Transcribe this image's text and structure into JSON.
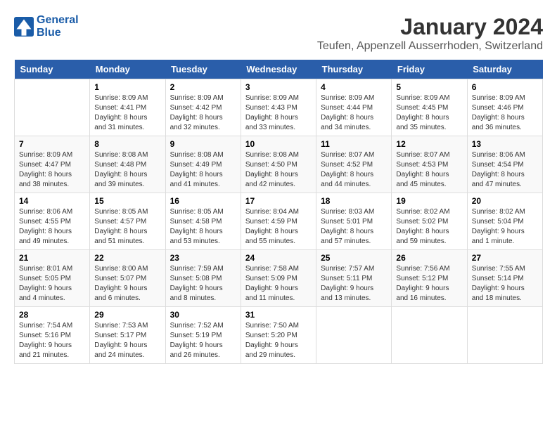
{
  "logo": {
    "line1": "General",
    "line2": "Blue"
  },
  "title": "January 2024",
  "subtitle": "Teufen, Appenzell Ausserrhoden, Switzerland",
  "days_header": [
    "Sunday",
    "Monday",
    "Tuesday",
    "Wednesday",
    "Thursday",
    "Friday",
    "Saturday"
  ],
  "weeks": [
    [
      {
        "day": "",
        "sunrise": "",
        "sunset": "",
        "daylight": ""
      },
      {
        "day": "1",
        "sunrise": "Sunrise: 8:09 AM",
        "sunset": "Sunset: 4:41 PM",
        "daylight": "Daylight: 8 hours and 31 minutes."
      },
      {
        "day": "2",
        "sunrise": "Sunrise: 8:09 AM",
        "sunset": "Sunset: 4:42 PM",
        "daylight": "Daylight: 8 hours and 32 minutes."
      },
      {
        "day": "3",
        "sunrise": "Sunrise: 8:09 AM",
        "sunset": "Sunset: 4:43 PM",
        "daylight": "Daylight: 8 hours and 33 minutes."
      },
      {
        "day": "4",
        "sunrise": "Sunrise: 8:09 AM",
        "sunset": "Sunset: 4:44 PM",
        "daylight": "Daylight: 8 hours and 34 minutes."
      },
      {
        "day": "5",
        "sunrise": "Sunrise: 8:09 AM",
        "sunset": "Sunset: 4:45 PM",
        "daylight": "Daylight: 8 hours and 35 minutes."
      },
      {
        "day": "6",
        "sunrise": "Sunrise: 8:09 AM",
        "sunset": "Sunset: 4:46 PM",
        "daylight": "Daylight: 8 hours and 36 minutes."
      }
    ],
    [
      {
        "day": "7",
        "sunrise": "Sunrise: 8:09 AM",
        "sunset": "Sunset: 4:47 PM",
        "daylight": "Daylight: 8 hours and 38 minutes."
      },
      {
        "day": "8",
        "sunrise": "Sunrise: 8:08 AM",
        "sunset": "Sunset: 4:48 PM",
        "daylight": "Daylight: 8 hours and 39 minutes."
      },
      {
        "day": "9",
        "sunrise": "Sunrise: 8:08 AM",
        "sunset": "Sunset: 4:49 PM",
        "daylight": "Daylight: 8 hours and 41 minutes."
      },
      {
        "day": "10",
        "sunrise": "Sunrise: 8:08 AM",
        "sunset": "Sunset: 4:50 PM",
        "daylight": "Daylight: 8 hours and 42 minutes."
      },
      {
        "day": "11",
        "sunrise": "Sunrise: 8:07 AM",
        "sunset": "Sunset: 4:52 PM",
        "daylight": "Daylight: 8 hours and 44 minutes."
      },
      {
        "day": "12",
        "sunrise": "Sunrise: 8:07 AM",
        "sunset": "Sunset: 4:53 PM",
        "daylight": "Daylight: 8 hours and 45 minutes."
      },
      {
        "day": "13",
        "sunrise": "Sunrise: 8:06 AM",
        "sunset": "Sunset: 4:54 PM",
        "daylight": "Daylight: 8 hours and 47 minutes."
      }
    ],
    [
      {
        "day": "14",
        "sunrise": "Sunrise: 8:06 AM",
        "sunset": "Sunset: 4:55 PM",
        "daylight": "Daylight: 8 hours and 49 minutes."
      },
      {
        "day": "15",
        "sunrise": "Sunrise: 8:05 AM",
        "sunset": "Sunset: 4:57 PM",
        "daylight": "Daylight: 8 hours and 51 minutes."
      },
      {
        "day": "16",
        "sunrise": "Sunrise: 8:05 AM",
        "sunset": "Sunset: 4:58 PM",
        "daylight": "Daylight: 8 hours and 53 minutes."
      },
      {
        "day": "17",
        "sunrise": "Sunrise: 8:04 AM",
        "sunset": "Sunset: 4:59 PM",
        "daylight": "Daylight: 8 hours and 55 minutes."
      },
      {
        "day": "18",
        "sunrise": "Sunrise: 8:03 AM",
        "sunset": "Sunset: 5:01 PM",
        "daylight": "Daylight: 8 hours and 57 minutes."
      },
      {
        "day": "19",
        "sunrise": "Sunrise: 8:02 AM",
        "sunset": "Sunset: 5:02 PM",
        "daylight": "Daylight: 8 hours and 59 minutes."
      },
      {
        "day": "20",
        "sunrise": "Sunrise: 8:02 AM",
        "sunset": "Sunset: 5:04 PM",
        "daylight": "Daylight: 9 hours and 1 minute."
      }
    ],
    [
      {
        "day": "21",
        "sunrise": "Sunrise: 8:01 AM",
        "sunset": "Sunset: 5:05 PM",
        "daylight": "Daylight: 9 hours and 4 minutes."
      },
      {
        "day": "22",
        "sunrise": "Sunrise: 8:00 AM",
        "sunset": "Sunset: 5:07 PM",
        "daylight": "Daylight: 9 hours and 6 minutes."
      },
      {
        "day": "23",
        "sunrise": "Sunrise: 7:59 AM",
        "sunset": "Sunset: 5:08 PM",
        "daylight": "Daylight: 9 hours and 8 minutes."
      },
      {
        "day": "24",
        "sunrise": "Sunrise: 7:58 AM",
        "sunset": "Sunset: 5:09 PM",
        "daylight": "Daylight: 9 hours and 11 minutes."
      },
      {
        "day": "25",
        "sunrise": "Sunrise: 7:57 AM",
        "sunset": "Sunset: 5:11 PM",
        "daylight": "Daylight: 9 hours and 13 minutes."
      },
      {
        "day": "26",
        "sunrise": "Sunrise: 7:56 AM",
        "sunset": "Sunset: 5:12 PM",
        "daylight": "Daylight: 9 hours and 16 minutes."
      },
      {
        "day": "27",
        "sunrise": "Sunrise: 7:55 AM",
        "sunset": "Sunset: 5:14 PM",
        "daylight": "Daylight: 9 hours and 18 minutes."
      }
    ],
    [
      {
        "day": "28",
        "sunrise": "Sunrise: 7:54 AM",
        "sunset": "Sunset: 5:16 PM",
        "daylight": "Daylight: 9 hours and 21 minutes."
      },
      {
        "day": "29",
        "sunrise": "Sunrise: 7:53 AM",
        "sunset": "Sunset: 5:17 PM",
        "daylight": "Daylight: 9 hours and 24 minutes."
      },
      {
        "day": "30",
        "sunrise": "Sunrise: 7:52 AM",
        "sunset": "Sunset: 5:19 PM",
        "daylight": "Daylight: 9 hours and 26 minutes."
      },
      {
        "day": "31",
        "sunrise": "Sunrise: 7:50 AM",
        "sunset": "Sunset: 5:20 PM",
        "daylight": "Daylight: 9 hours and 29 minutes."
      },
      {
        "day": "",
        "sunrise": "",
        "sunset": "",
        "daylight": ""
      },
      {
        "day": "",
        "sunrise": "",
        "sunset": "",
        "daylight": ""
      },
      {
        "day": "",
        "sunrise": "",
        "sunset": "",
        "daylight": ""
      }
    ]
  ]
}
